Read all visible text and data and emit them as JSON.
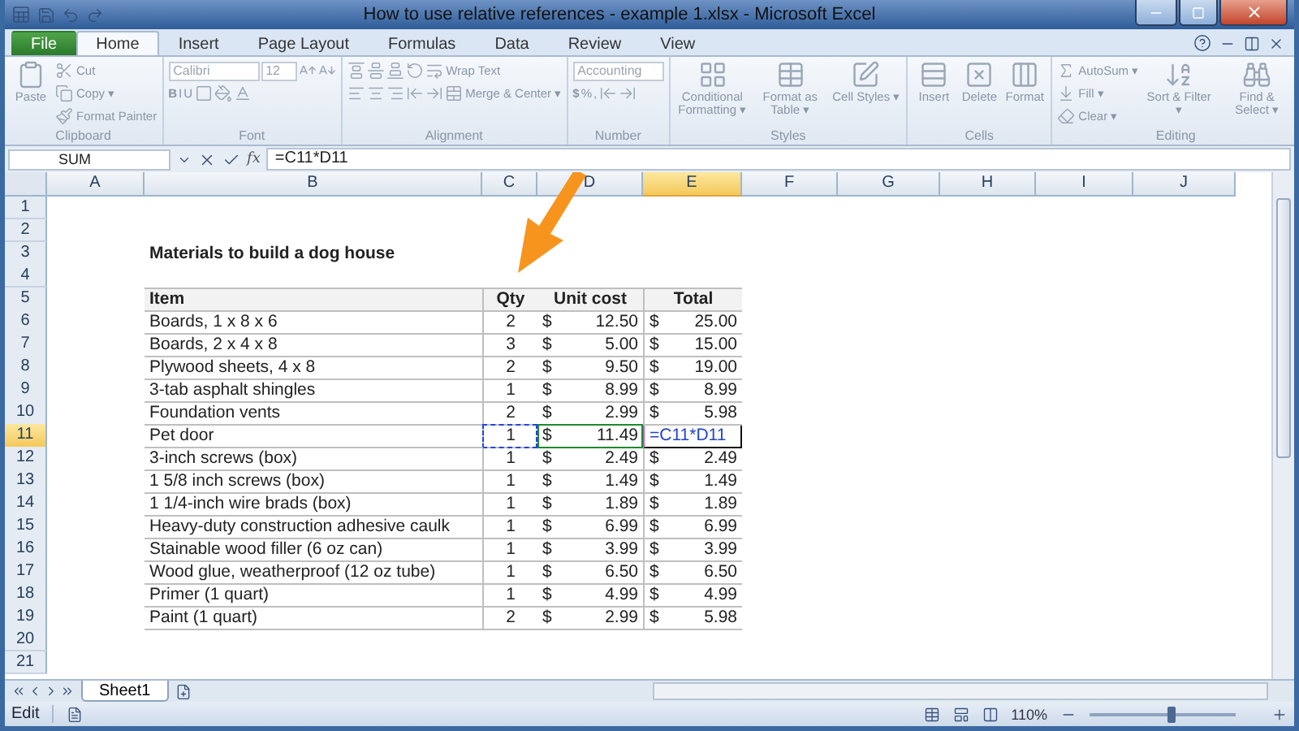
{
  "window": {
    "title": "How to use relative references - example 1.xlsx - Microsoft Excel"
  },
  "tabs": [
    {
      "label": "File",
      "kind": "file",
      "selected": false
    },
    {
      "label": "Home",
      "kind": "tab",
      "selected": true
    },
    {
      "label": "Insert",
      "kind": "tab",
      "selected": false
    },
    {
      "label": "Page Layout",
      "kind": "tab",
      "selected": false
    },
    {
      "label": "Formulas",
      "kind": "tab",
      "selected": false
    },
    {
      "label": "Data",
      "kind": "tab",
      "selected": false
    },
    {
      "label": "Review",
      "kind": "tab",
      "selected": false
    },
    {
      "label": "View",
      "kind": "tab",
      "selected": false
    }
  ],
  "ribbon": {
    "disabled": true,
    "groups": [
      {
        "label": "Clipboard",
        "items": [
          {
            "kind": "large",
            "label": "Paste"
          },
          {
            "kind": "stack",
            "lines": [
              {
                "items": [
                  {
                    "kind": "button",
                    "label": "Cut"
                  }
                ]
              },
              {
                "items": [
                  {
                    "kind": "button",
                    "label": "Copy ▾"
                  }
                ]
              },
              {
                "items": [
                  {
                    "kind": "button",
                    "label": "Format Painter"
                  }
                ]
              }
            ]
          }
        ]
      },
      {
        "label": "Font",
        "items": [
          {
            "kind": "stack",
            "lines": [
              {
                "items": [
                  {
                    "kind": "field",
                    "value": "Calibri"
                  },
                  {
                    "kind": "small_field",
                    "value": "12"
                  },
                  {
                    "kind": "icon"
                  },
                  {
                    "kind": "icon"
                  }
                ]
              },
              {
                "items": [
                  {
                    "kind": "glyph",
                    "label": "B"
                  },
                  {
                    "kind": "glyph",
                    "label": "I"
                  },
                  {
                    "kind": "glyph",
                    "label": "U"
                  },
                  {
                    "kind": "icon"
                  },
                  {
                    "kind": "icon"
                  },
                  {
                    "kind": "icon"
                  }
                ]
              }
            ]
          }
        ]
      },
      {
        "label": "Alignment",
        "items": [
          {
            "kind": "stack",
            "lines": [
              {
                "items": [
                  {
                    "kind": "icon"
                  },
                  {
                    "kind": "icon"
                  },
                  {
                    "kind": "icon"
                  },
                  {
                    "kind": "icon"
                  },
                  {
                    "kind": "button",
                    "label": "Wrap Text"
                  }
                ]
              },
              {
                "items": [
                  {
                    "kind": "icon"
                  },
                  {
                    "kind": "icon"
                  },
                  {
                    "kind": "icon"
                  },
                  {
                    "kind": "icon"
                  },
                  {
                    "kind": "icon"
                  },
                  {
                    "kind": "button",
                    "label": "Merge & Center ▾"
                  }
                ]
              }
            ]
          }
        ]
      },
      {
        "label": "Number",
        "items": [
          {
            "kind": "stack",
            "lines": [
              {
                "items": [
                  {
                    "kind": "field",
                    "value": "Accounting"
                  }
                ]
              },
              {
                "items": [
                  {
                    "kind": "glyph",
                    "label": "$"
                  },
                  {
                    "kind": "glyph",
                    "label": "%"
                  },
                  {
                    "kind": "glyph",
                    "label": ","
                  },
                  {
                    "kind": "icon"
                  },
                  {
                    "kind": "icon"
                  }
                ]
              }
            ]
          }
        ]
      },
      {
        "label": "Styles",
        "items": [
          {
            "kind": "large",
            "label": "Conditional Formatting ▾"
          },
          {
            "kind": "large",
            "label": "Format as Table ▾"
          },
          {
            "kind": "large",
            "label": "Cell Styles ▾"
          }
        ]
      },
      {
        "label": "Cells",
        "items": [
          {
            "kind": "large",
            "label": "Insert"
          },
          {
            "kind": "large",
            "label": "Delete"
          },
          {
            "kind": "large",
            "label": "Format"
          }
        ]
      },
      {
        "label": "Editing",
        "items": [
          {
            "kind": "stack",
            "lines": [
              {
                "items": [
                  {
                    "kind": "button",
                    "label": "AutoSum ▾"
                  }
                ]
              },
              {
                "items": [
                  {
                    "kind": "button",
                    "label": "Fill ▾"
                  }
                ]
              },
              {
                "items": [
                  {
                    "kind": "button",
                    "label": "Clear ▾"
                  }
                ]
              }
            ]
          },
          {
            "kind": "large",
            "label": "Sort & Filter ▾"
          },
          {
            "kind": "large",
            "label": "Find & Select ▾"
          }
        ]
      }
    ]
  },
  "formula_bar": {
    "name_box": "SUM",
    "function_label": "fx",
    "formula": "=C11*D11"
  },
  "columns": [
    {
      "label": "A",
      "selected": false
    },
    {
      "label": "B",
      "selected": false
    },
    {
      "label": "C",
      "selected": false
    },
    {
      "label": "D",
      "selected": false
    },
    {
      "label": "E",
      "selected": true
    },
    {
      "label": "F",
      "selected": false
    },
    {
      "label": "G",
      "selected": false
    },
    {
      "label": "H",
      "selected": false
    },
    {
      "label": "I",
      "selected": false
    },
    {
      "label": "J",
      "selected": false
    }
  ],
  "rows": [
    {
      "number": "1",
      "kind": "blank",
      "selected": false
    },
    {
      "number": "2",
      "kind": "blank",
      "selected": false
    },
    {
      "number": "3",
      "kind": "title",
      "selected": false,
      "text": "Materials to build a dog house"
    },
    {
      "number": "4",
      "kind": "blank",
      "selected": false
    },
    {
      "number": "5",
      "kind": "header",
      "selected": false,
      "item": "Item",
      "qty": "Qty",
      "unit_cost": "Unit cost",
      "total": "Total"
    },
    {
      "number": "6",
      "kind": "item",
      "selected": false,
      "item": "Boards, 1 x 8 x 6",
      "qty": "2",
      "cost_currency": "$",
      "unit_cost": "12.50",
      "total_currency": "$",
      "total": "25.00"
    },
    {
      "number": "7",
      "kind": "item",
      "selected": false,
      "item": "Boards, 2 x 4 x 8",
      "qty": "3",
      "cost_currency": "$",
      "unit_cost": "5.00",
      "total_currency": "$",
      "total": "15.00"
    },
    {
      "number": "8",
      "kind": "item",
      "selected": false,
      "item": "Plywood sheets, 4 x 8",
      "qty": "2",
      "cost_currency": "$",
      "unit_cost": "9.50",
      "total_currency": "$",
      "total": "19.00"
    },
    {
      "number": "9",
      "kind": "item",
      "selected": false,
      "item": "3-tab asphalt shingles",
      "qty": "1",
      "cost_currency": "$",
      "unit_cost": "8.99",
      "total_currency": "$",
      "total": "8.99"
    },
    {
      "number": "10",
      "kind": "item",
      "selected": false,
      "item": "Foundation vents",
      "qty": "2",
      "cost_currency": "$",
      "unit_cost": "2.99",
      "total_currency": "$",
      "total": "5.98"
    },
    {
      "number": "11",
      "kind": "editing",
      "selected": true,
      "item": "Pet door",
      "qty": "1",
      "cost_currency": "$",
      "unit_cost": "11.49",
      "total": "=C11*D11"
    },
    {
      "number": "12",
      "kind": "item",
      "selected": false,
      "item": "3-inch screws (box)",
      "qty": "1",
      "cost_currency": "$",
      "unit_cost": "2.49",
      "total_currency": "$",
      "total": "2.49"
    },
    {
      "number": "13",
      "kind": "item",
      "selected": false,
      "item": "1 5/8 inch screws (box)",
      "qty": "1",
      "cost_currency": "$",
      "unit_cost": "1.49",
      "total_currency": "$",
      "total": "1.49"
    },
    {
      "number": "14",
      "kind": "item",
      "selected": false,
      "item": "1 1/4-inch wire brads (box)",
      "qty": "1",
      "cost_currency": "$",
      "unit_cost": "1.89",
      "total_currency": "$",
      "total": "1.89"
    },
    {
      "number": "15",
      "kind": "item",
      "selected": false,
      "item": "Heavy-duty construction adhesive caulk",
      "qty": "1",
      "cost_currency": "$",
      "unit_cost": "6.99",
      "total_currency": "$",
      "total": "6.99"
    },
    {
      "number": "16",
      "kind": "item",
      "selected": false,
      "item": "Stainable wood filler (6 oz can)",
      "qty": "1",
      "cost_currency": "$",
      "unit_cost": "3.99",
      "total_currency": "$",
      "total": "3.99"
    },
    {
      "number": "17",
      "kind": "item",
      "selected": false,
      "item": "Wood glue, weatherproof (12 oz tube)",
      "qty": "1",
      "cost_currency": "$",
      "unit_cost": "6.50",
      "total_currency": "$",
      "total": "6.50"
    },
    {
      "number": "18",
      "kind": "item",
      "selected": false,
      "item": "Primer (1 quart)",
      "qty": "1",
      "cost_currency": "$",
      "unit_cost": "4.99",
      "total_currency": "$",
      "total": "4.99"
    },
    {
      "number": "19",
      "kind": "item",
      "selected": false,
      "item": "Paint (1 quart)",
      "qty": "2",
      "cost_currency": "$",
      "unit_cost": "2.99",
      "total_currency": "$",
      "total": "5.98"
    },
    {
      "number": "20",
      "kind": "blank",
      "selected": false
    },
    {
      "number": "21",
      "kind": "blank",
      "selected": false
    }
  ],
  "sheet_tabs": [
    {
      "label": "Sheet1",
      "selected": true
    }
  ],
  "status_bar": {
    "mode": "Edit",
    "zoom": "110%",
    "zoom_level": {
      "level": 0.55
    }
  }
}
